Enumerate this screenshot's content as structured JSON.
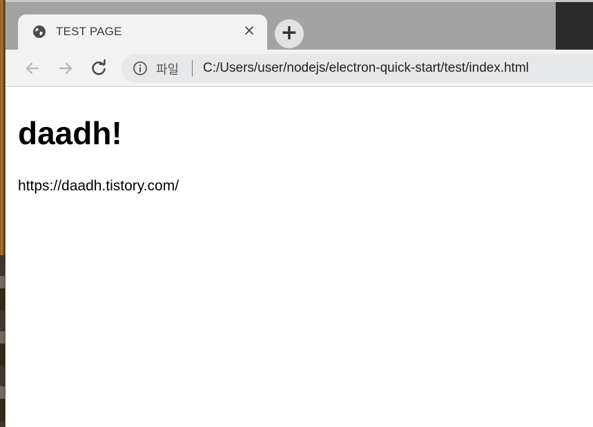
{
  "tab": {
    "title": "TEST PAGE",
    "close_glyph": "×",
    "icon": "globe-icon"
  },
  "new_tab_glyph": "+",
  "toolbar": {
    "back_icon": "arrow-left-icon",
    "forward_icon": "arrow-right-icon",
    "reload_icon": "reload-icon"
  },
  "omnibox": {
    "info_icon": "info-icon",
    "scheme_label": "파일",
    "url": "C:/Users/user/nodejs/electron-quick-start/test/index.html"
  },
  "page": {
    "heading": "daadh!",
    "text": "https://daadh.tistory.com/"
  }
}
